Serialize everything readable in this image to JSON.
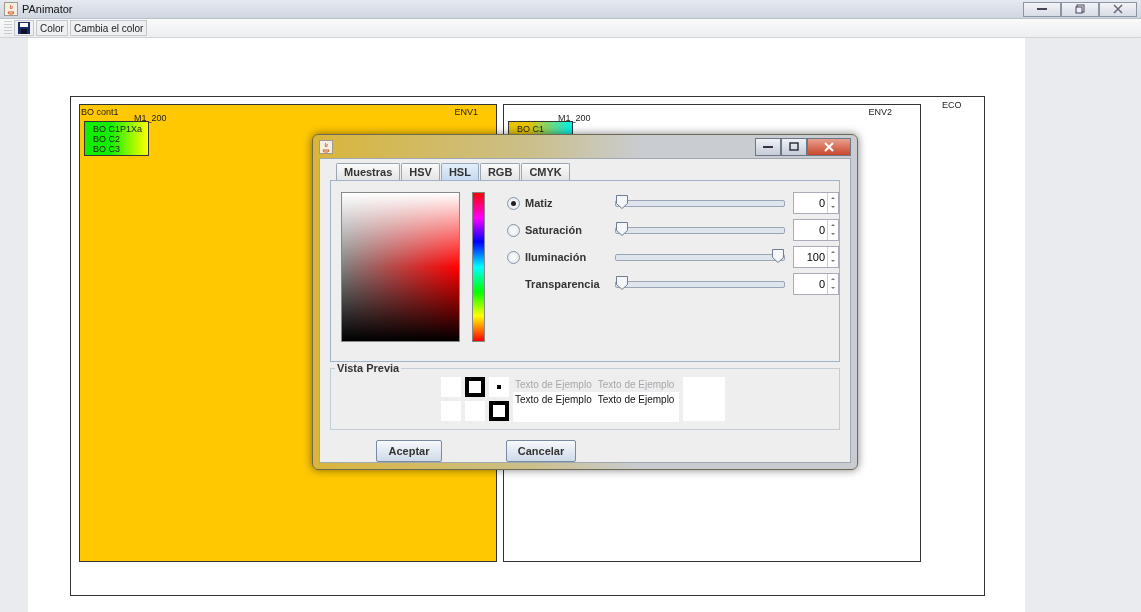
{
  "window": {
    "title": "PAnimator"
  },
  "toolbar": {
    "buttons": [
      "Color",
      "Cambia el color"
    ]
  },
  "canvas": {
    "eco": {
      "label": "ECO"
    },
    "environments": [
      {
        "label": "ENV1",
        "color": "#ffc800",
        "owner": "BO cont1",
        "tag": "M1_200",
        "object": {
          "kind": "green",
          "lines": [
            "BO C1P1Xa",
            "BO C2",
            "BO C3"
          ]
        }
      },
      {
        "label": "ENV2",
        "color": "#ffffff",
        "tag": "M1_200",
        "object": {
          "kind": "cyan",
          "lines": [
            "BO C1"
          ]
        }
      }
    ]
  },
  "dialog": {
    "tabs": [
      {
        "label": "Muestras",
        "selected": false
      },
      {
        "label": "HSV",
        "selected": false
      },
      {
        "label": "HSL",
        "selected": true
      },
      {
        "label": "RGB",
        "selected": false
      },
      {
        "label": "CMYK",
        "selected": false
      }
    ],
    "channels": [
      {
        "kind": "radio",
        "label": "Matiz",
        "selected": true,
        "level": 0,
        "value": "0"
      },
      {
        "kind": "radio",
        "label": "Saturación",
        "selected": false,
        "level": 0,
        "value": "0"
      },
      {
        "kind": "radio",
        "label": "Iluminación",
        "selected": false,
        "level": 1,
        "value": "100"
      },
      {
        "kind": "plain",
        "label": "Transparencia",
        "level": 0,
        "value": "0"
      }
    ],
    "preview": {
      "title": "Vista Previa",
      "rows": [
        {
          "kind": "light",
          "texts": [
            "Texto de Ejemplo",
            "Texto de Ejemplo"
          ]
        },
        {
          "kind": "dark",
          "texts": [
            "Texto de Ejemplo",
            "Texto de Ejemplo"
          ]
        }
      ]
    },
    "buttons": [
      "Aceptar",
      "Cancelar"
    ]
  }
}
